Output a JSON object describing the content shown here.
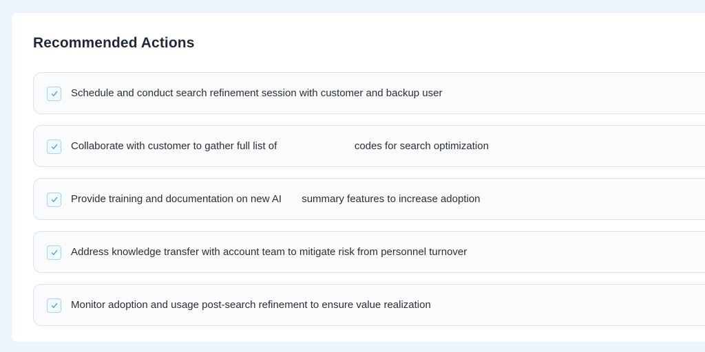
{
  "panel": {
    "title": "Recommended Actions"
  },
  "actions": [
    {
      "text": "Schedule and conduct search refinement session with customer and backup user",
      "checked": true
    },
    {
      "text": "Collaborate with customer to gather full list of                           codes for search optimization",
      "checked": true
    },
    {
      "text": "Provide training and documentation on new AI       summary features to increase adoption",
      "checked": true
    },
    {
      "text": "Address knowledge transfer with account team to mitigate risk from personnel turnover",
      "checked": true
    },
    {
      "text": "Monitor adoption and usage post-search refinement to ensure value realization",
      "checked": true
    }
  ],
  "colors": {
    "background": "#eef4fb",
    "card": "#ffffff",
    "item_border": "#d8e3ef",
    "check_accent": "#4aa8dc"
  },
  "icons": {
    "check": "checkmark-icon"
  }
}
